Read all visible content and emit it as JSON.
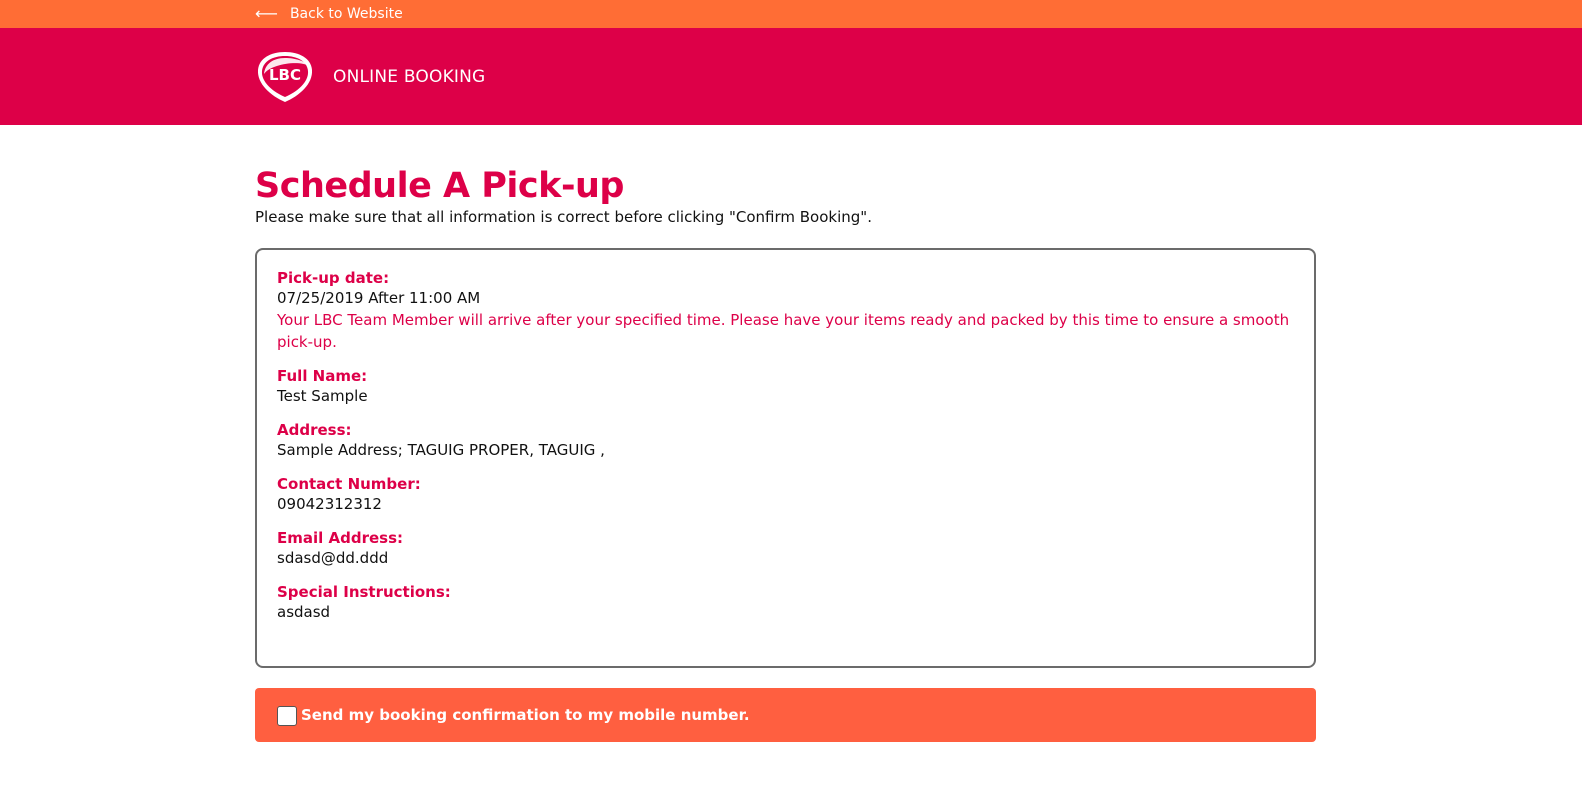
{
  "topbar": {
    "back_arrow": "⟵",
    "back_label": "Back to Website"
  },
  "header": {
    "logo_text": "LBC",
    "title": "ONLINE BOOKING"
  },
  "main": {
    "title": "Schedule A Pick-up",
    "subtitle": "Please make sure that all information is correct before clicking \"Confirm Booking\"."
  },
  "details": {
    "pickup_date": {
      "label": "Pick-up date:",
      "value": "07/25/2019 After 11:00 AM",
      "note": "Your LBC Team Member will arrive after your specified time. Please have your items ready and packed by this time to ensure a smooth pick-up."
    },
    "full_name": {
      "label": "Full Name:",
      "value": "Test Sample"
    },
    "address": {
      "label": "Address:",
      "value": "Sample Address; TAGUIG PROPER, TAGUIG ,"
    },
    "contact_number": {
      "label": "Contact Number:",
      "value": "09042312312"
    },
    "email": {
      "label": "Email Address:",
      "value": "sdasd@dd.ddd"
    },
    "special_instructions": {
      "label": "Special Instructions:",
      "value": "asdasd"
    }
  },
  "sms_confirmation": {
    "label": "Send my booking confirmation to my mobile number.",
    "checked": false
  },
  "colors": {
    "brand_red": "#dd0048",
    "topbar_orange": "#ff6d35",
    "confirm_orange": "#ff5f40"
  }
}
